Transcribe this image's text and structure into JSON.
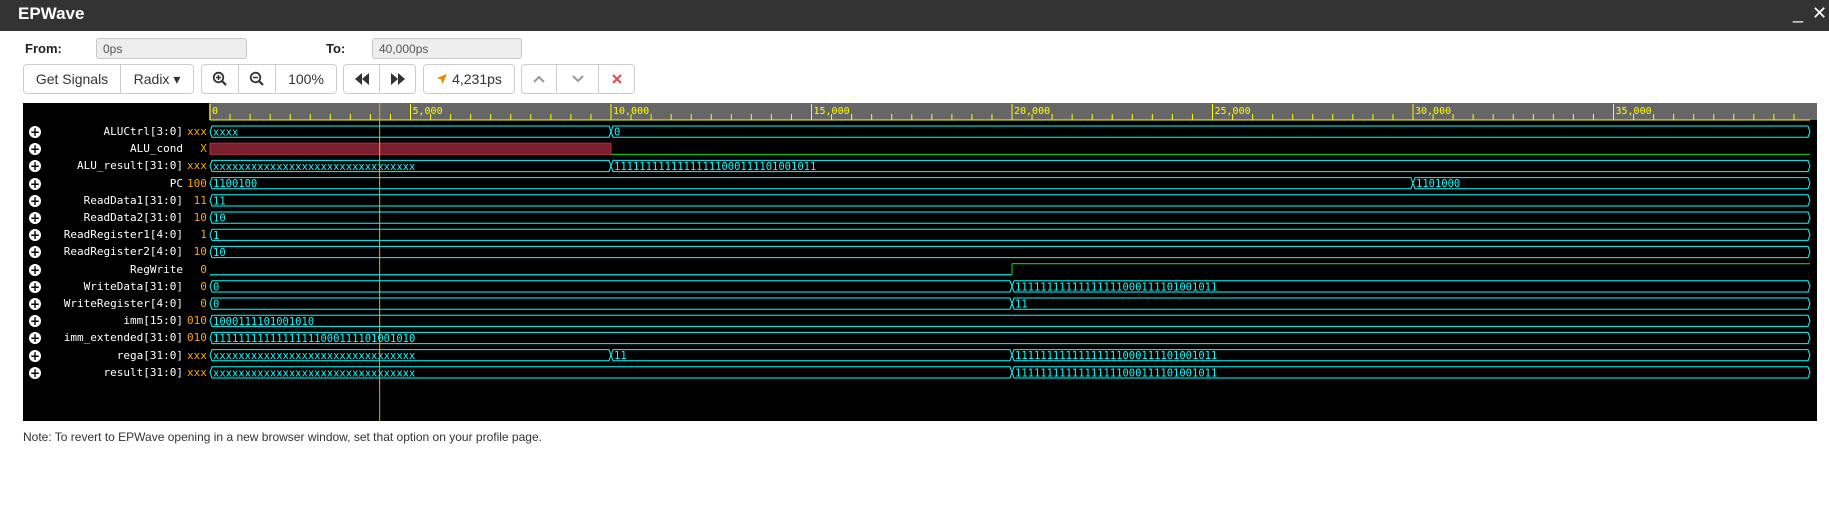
{
  "window": {
    "title": "EPWave",
    "minimize_label": "_",
    "close_label": "✕"
  },
  "range": {
    "from_label": "From:",
    "from_value": "0ps",
    "to_label": "To:",
    "to_value": "40,000ps"
  },
  "toolbar": {
    "get_signals": "Get Signals",
    "radix": "Radix ▾",
    "zoom_level": "100%",
    "cursor_time": "4,231ps",
    "icons": [
      "zoom-in-icon",
      "zoom-out-icon",
      "rewind-icon",
      "fast-forward-icon",
      "cursor-arrow-icon",
      "chevron-up-icon",
      "chevron-down-icon",
      "close-icon"
    ]
  },
  "ruler": {
    "ticks": [
      "0",
      "5,000",
      "10,000",
      "15,000",
      "20,000",
      "25,000",
      "30,000",
      "35,000"
    ],
    "time_range_ps": [
      0,
      40000
    ],
    "cursor_ps": 4231
  },
  "colors": {
    "wave": "#00ffff",
    "bit_high": "#00c000",
    "undefined_fill": "#7a1f2e",
    "value_label": "#ffa500",
    "ruler_text": "#ffff00"
  },
  "signals": [
    {
      "name": "ALUCtrl[3:0]",
      "value": "xxx",
      "type": "bus",
      "segments": [
        {
          "start": 0,
          "end": 10000,
          "label": "xxxx"
        },
        {
          "start": 10000,
          "end": 40000,
          "label": "0"
        }
      ]
    },
    {
      "name": "ALU_cond",
      "value": "X",
      "type": "bit",
      "segments": [
        {
          "start": 0,
          "end": 10000,
          "level": "x"
        },
        {
          "start": 10000,
          "end": 40000,
          "level": "0"
        }
      ]
    },
    {
      "name": "ALU_result[31:0]",
      "value": "xxx",
      "type": "bus",
      "segments": [
        {
          "start": 0,
          "end": 10000,
          "label": "xxxxxxxxxxxxxxxxxxxxxxxxxxxxxxxx"
        },
        {
          "start": 10000,
          "end": 40000,
          "label": "11111111111111111000111101001011"
        }
      ]
    },
    {
      "name": "PC",
      "value": "100",
      "type": "bus",
      "segments": [
        {
          "start": 0,
          "end": 30000,
          "label": "1100100"
        },
        {
          "start": 30000,
          "end": 40000,
          "label": "1101000"
        }
      ]
    },
    {
      "name": "ReadData1[31:0]",
      "value": "11",
      "type": "bus",
      "segments": [
        {
          "start": 0,
          "end": 40000,
          "label": "11"
        }
      ]
    },
    {
      "name": "ReadData2[31:0]",
      "value": "10",
      "type": "bus",
      "segments": [
        {
          "start": 0,
          "end": 40000,
          "label": "10"
        }
      ]
    },
    {
      "name": "ReadRegister1[4:0]",
      "value": "1",
      "type": "bus",
      "segments": [
        {
          "start": 0,
          "end": 40000,
          "label": "1"
        }
      ]
    },
    {
      "name": "ReadRegister2[4:0]",
      "value": "10",
      "type": "bus",
      "segments": [
        {
          "start": 0,
          "end": 40000,
          "label": "10"
        }
      ]
    },
    {
      "name": "RegWrite",
      "value": "0",
      "type": "bit",
      "segments": [
        {
          "start": 0,
          "end": 20000,
          "level": "0"
        },
        {
          "start": 20000,
          "end": 40000,
          "level": "1"
        }
      ]
    },
    {
      "name": "WriteData[31:0]",
      "value": "0",
      "type": "bus",
      "segments": [
        {
          "start": 0,
          "end": 20000,
          "label": "0"
        },
        {
          "start": 20000,
          "end": 40000,
          "label": "11111111111111111000111101001011"
        }
      ]
    },
    {
      "name": "WriteRegister[4:0]",
      "value": "0",
      "type": "bus",
      "segments": [
        {
          "start": 0,
          "end": 20000,
          "label": "0"
        },
        {
          "start": 20000,
          "end": 40000,
          "label": "11"
        }
      ]
    },
    {
      "name": "imm[15:0]",
      "value": "010",
      "type": "bus",
      "segments": [
        {
          "start": 0,
          "end": 40000,
          "label": "1000111101001010"
        }
      ]
    },
    {
      "name": "imm_extended[31:0]",
      "value": "010",
      "type": "bus",
      "segments": [
        {
          "start": 0,
          "end": 40000,
          "label": "11111111111111111000111101001010"
        }
      ]
    },
    {
      "name": "rega[31:0]",
      "value": "xxx",
      "type": "bus",
      "segments": [
        {
          "start": 0,
          "end": 10000,
          "label": "xxxxxxxxxxxxxxxxxxxxxxxxxxxxxxxx"
        },
        {
          "start": 10000,
          "end": 20000,
          "label": "11"
        },
        {
          "start": 20000,
          "end": 40000,
          "label": "11111111111111111000111101001011"
        }
      ]
    },
    {
      "name": "result[31:0]",
      "value": "xxx",
      "type": "bus",
      "segments": [
        {
          "start": 0,
          "end": 20000,
          "label": "xxxxxxxxxxxxxxxxxxxxxxxxxxxxxxxx"
        },
        {
          "start": 20000,
          "end": 40000,
          "label": "11111111111111111000111101001011"
        }
      ]
    }
  ],
  "note": "Note: To revert to EPWave opening in a new browser window, set that option on your profile page."
}
